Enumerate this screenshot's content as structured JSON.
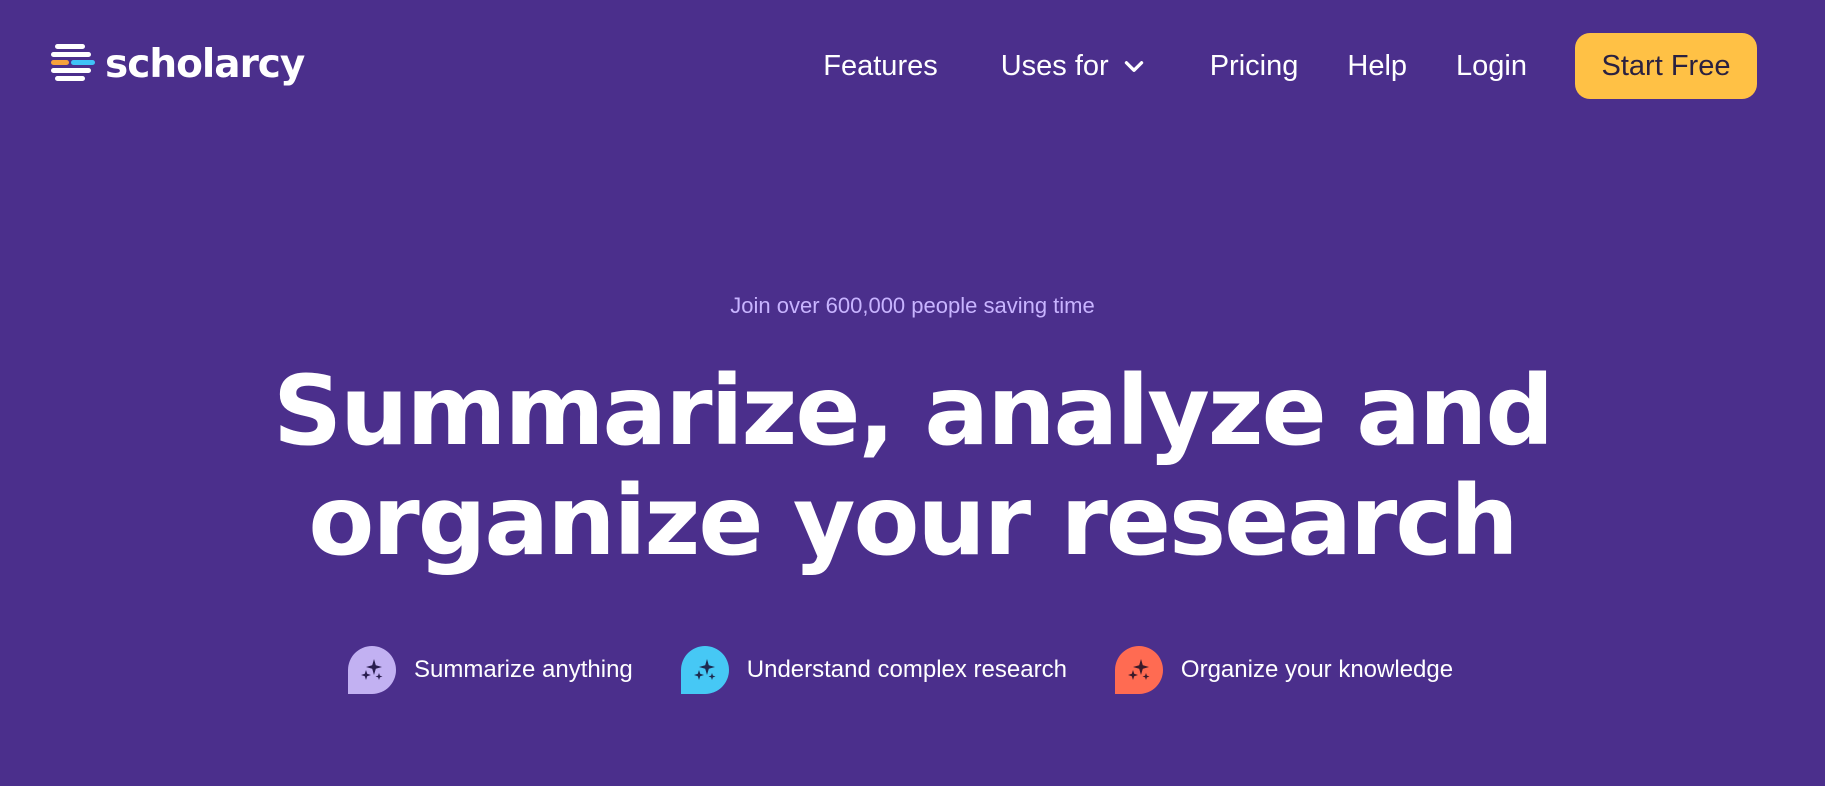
{
  "brand": {
    "name": "scholarcy",
    "logo_colors": [
      "#ffffff",
      "#ffffff",
      "#f6a23c",
      "#3fc3f7",
      "#ffffff",
      "#ffffff"
    ]
  },
  "nav": {
    "items": [
      {
        "label": "Features"
      },
      {
        "label": "Uses for"
      },
      {
        "label": "Pricing"
      },
      {
        "label": "Help"
      },
      {
        "label": "Login"
      }
    ],
    "cta": "Start Free"
  },
  "hero": {
    "eyebrow": "Join over 600,000 people saving time",
    "headline_line1": "Summarize, analyze and",
    "headline_line2": "organize your research"
  },
  "features": [
    {
      "label": "Summarize anything",
      "icon": "sparkle-icon",
      "color": "#c2b1f2"
    },
    {
      "label": "Understand complex research",
      "icon": "sparkle-icon",
      "color": "#46c8f5"
    },
    {
      "label": "Organize your knowledge",
      "icon": "sparkle-icon",
      "color": "#ff6b52"
    }
  ],
  "colors": {
    "background": "#4b2f8c",
    "cta": "#ffc145",
    "eyebrow": "#c8b4ff"
  }
}
